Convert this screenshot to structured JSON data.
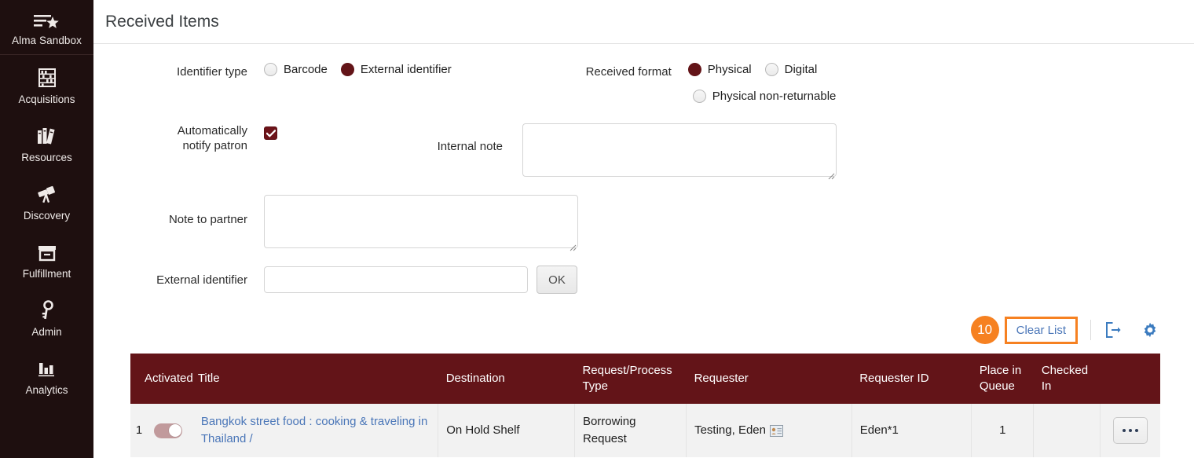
{
  "sidebar": {
    "brand": {
      "label": "Alma Sandbox",
      "icon": "alma-star-icon"
    },
    "items": [
      {
        "label": "Acquisitions",
        "icon": "abacus-icon"
      },
      {
        "label": "Resources",
        "icon": "books-icon"
      },
      {
        "label": "Discovery",
        "icon": "telescope-icon"
      },
      {
        "label": "Fulfillment",
        "icon": "archive-box-icon"
      },
      {
        "label": "Admin",
        "icon": "key-icon"
      },
      {
        "label": "Analytics",
        "icon": "bar-chart-icon"
      }
    ]
  },
  "header": {
    "title": "Received Items"
  },
  "form": {
    "identifier_type": {
      "label": "Identifier type",
      "options": [
        {
          "label": "Barcode",
          "selected": false
        },
        {
          "label": "External identifier",
          "selected": true
        }
      ]
    },
    "received_format": {
      "label": "Received format",
      "options": [
        {
          "label": "Physical",
          "selected": true
        },
        {
          "label": "Digital",
          "selected": false
        },
        {
          "label": "Physical non-returnable",
          "selected": false
        }
      ]
    },
    "auto_notify": {
      "label_line1": "Automatically",
      "label_line2": "notify patron",
      "checked": true
    },
    "internal_note": {
      "label": "Internal note",
      "value": "",
      "placeholder": ""
    },
    "note_to_partner": {
      "label": "Note to partner",
      "value": "",
      "placeholder": ""
    },
    "external_identifier": {
      "label": "External identifier",
      "value": "",
      "placeholder": "",
      "ok_label": "OK"
    }
  },
  "toolbar": {
    "badge_count": "10",
    "clear_list_label": "Clear List",
    "export_icon": "export-icon",
    "settings_icon": "gear-icon"
  },
  "table": {
    "columns": [
      "Activated",
      "Title",
      "Destination",
      "Request/Process Type",
      "Requester",
      "Requester ID",
      "Place in Queue",
      "Checked In"
    ],
    "rows": [
      {
        "index": "1",
        "activated": true,
        "title": "Bangkok street food : cooking & traveling in Thailand /",
        "destination": "On Hold Shelf",
        "request_type": "Borrowing Request",
        "requester": "Testing, Eden",
        "requester_icon": "contact-card-icon",
        "requester_id": "Eden*1",
        "place_in_queue": "1",
        "checked_in": "",
        "actions_label": "..."
      }
    ]
  },
  "colors": {
    "sidebar_bg": "#1e0f0f",
    "accent_maroon": "#631418",
    "badge_orange": "#f68121",
    "link_blue": "#4a76b8",
    "icon_blue": "#3b7bbf"
  }
}
